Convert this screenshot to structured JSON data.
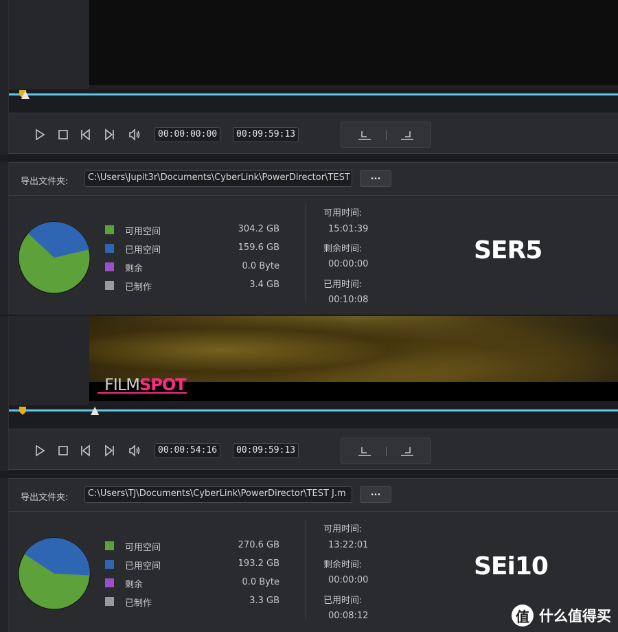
{
  "top": {
    "transport": {
      "current_time": "00:00:00:00",
      "duration": "00:09:59:13"
    }
  },
  "panel_ser5": {
    "folder_label": "导出文件夹:",
    "path": "C:\\Users\\Jupit3r\\Documents\\CyberLink\\PowerDirector\\TEST",
    "browse_label": "...",
    "legend": [
      {
        "label": "可用空间",
        "value": "304.2  GB",
        "color": "#5ca13a"
      },
      {
        "label": "已用空间",
        "value": "159.6  GB",
        "color": "#2f66b3"
      },
      {
        "label": "剩余",
        "value": "0.0  Byte",
        "color": "#9b4fc9"
      },
      {
        "label": "已制作",
        "value": "3.4  GB",
        "color": "#9a9a9a"
      }
    ],
    "pie": {
      "free_gb": 304.2,
      "used_gb": 159.6
    },
    "available_time_label": "可用时间:",
    "available_time": "15:01:39",
    "remaining_time_label": "剩余时间:",
    "remaining_time": "00:00:00",
    "used_time_label": "已用时间:",
    "used_time": "00:10:08",
    "device_label": "SER5"
  },
  "middle": {
    "logo_part1": "FILM",
    "logo_part2": "SPOT",
    "transport": {
      "current_time": "00:00:54:16",
      "duration": "00:09:59:13"
    },
    "playhead_progress": 0.091
  },
  "panel_sei10": {
    "folder_label": "导出文件夹:",
    "path": "C:\\Users\\TJ\\Documents\\CyberLink\\PowerDirector\\TEST J.m",
    "browse_label": "...",
    "legend": [
      {
        "label": "可用空间",
        "value": "270.6  GB",
        "color": "#5ca13a"
      },
      {
        "label": "已用空间",
        "value": "193.2  GB",
        "color": "#2f66b3"
      },
      {
        "label": "剩余",
        "value": "0.0  Byte",
        "color": "#9b4fc9"
      },
      {
        "label": "已制作",
        "value": "3.3  GB",
        "color": "#9a9a9a"
      }
    ],
    "pie": {
      "free_gb": 270.6,
      "used_gb": 193.2
    },
    "available_time_label": "可用时间:",
    "available_time": "13:22:01",
    "remaining_time_label": "剩余时间:",
    "remaining_time": "00:00:00",
    "used_time_label": "已用时间:",
    "used_time": "00:08:12",
    "device_label": "SEi10"
  },
  "watermark": {
    "icon_text": "值",
    "text": "什么值得买"
  }
}
